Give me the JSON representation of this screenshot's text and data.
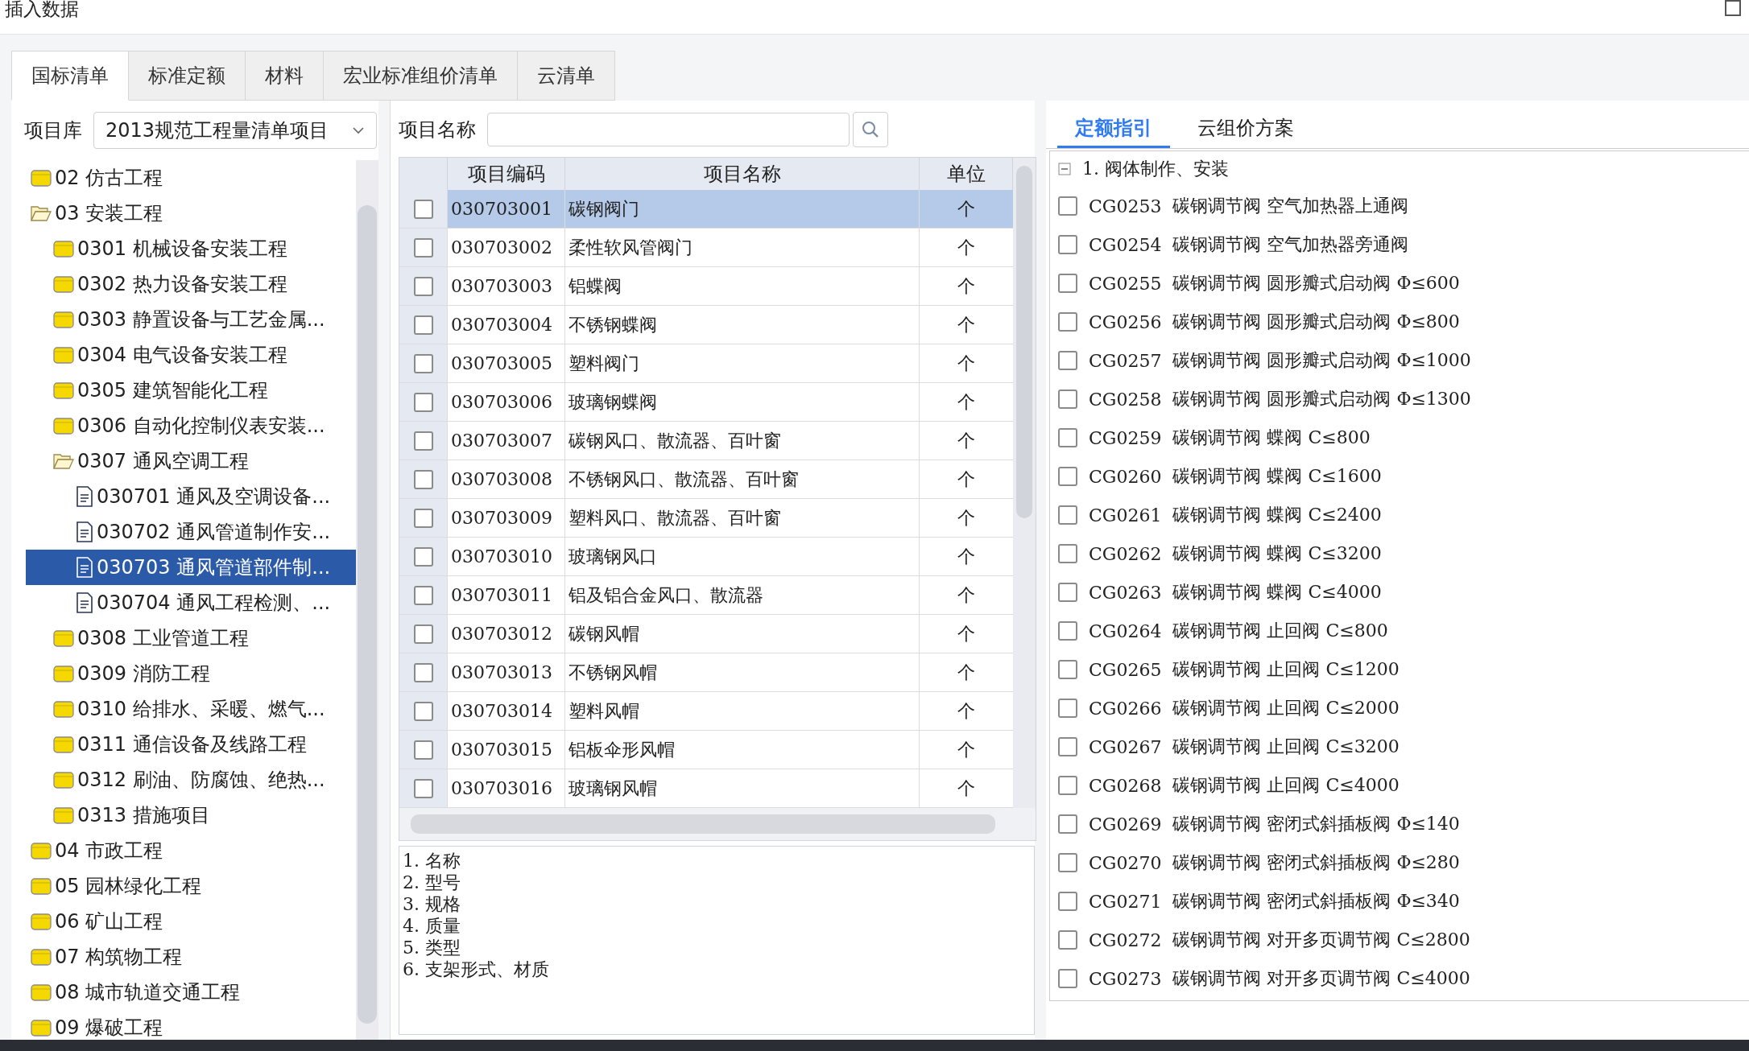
{
  "window": {
    "title": "插入数据"
  },
  "tabs": [
    {
      "label": "国标清单",
      "selected": true
    },
    {
      "label": "标准定额",
      "selected": false
    },
    {
      "label": "材料",
      "selected": false
    },
    {
      "label": "宏业标准组价清单",
      "selected": false
    },
    {
      "label": "云清单",
      "selected": false
    }
  ],
  "library": {
    "label": "项目库",
    "value": "2013规范工程量清单项目"
  },
  "tree": [
    {
      "label": "02 仿古工程",
      "kind": "folder",
      "expanded": false,
      "selected": false
    },
    {
      "label": "03 安装工程",
      "kind": "folder",
      "expanded": true,
      "selected": false,
      "children": [
        {
          "label": "0301 机械设备安装工程",
          "kind": "folder",
          "expanded": false,
          "selected": false
        },
        {
          "label": "0302 热力设备安装工程",
          "kind": "folder",
          "expanded": false,
          "selected": false
        },
        {
          "label": "0303 静置设备与工艺金属...",
          "kind": "folder",
          "expanded": false,
          "selected": false
        },
        {
          "label": "0304 电气设备安装工程",
          "kind": "folder",
          "expanded": false,
          "selected": false
        },
        {
          "label": "0305 建筑智能化工程",
          "kind": "folder",
          "expanded": false,
          "selected": false
        },
        {
          "label": "0306 自动化控制仪表安装...",
          "kind": "folder",
          "expanded": false,
          "selected": false
        },
        {
          "label": "0307 通风空调工程",
          "kind": "folder",
          "expanded": true,
          "selected": false,
          "children": [
            {
              "label": "030701 通风及空调设备...",
              "kind": "doc",
              "selected": false
            },
            {
              "label": "030702 通风管道制作安...",
              "kind": "doc",
              "selected": false
            },
            {
              "label": "030703 通风管道部件制...",
              "kind": "doc",
              "selected": true
            },
            {
              "label": "030704 通风工程检测、...",
              "kind": "doc",
              "selected": false
            }
          ]
        },
        {
          "label": "0308 工业管道工程",
          "kind": "folder",
          "expanded": false,
          "selected": false
        },
        {
          "label": "0309 消防工程",
          "kind": "folder",
          "expanded": false,
          "selected": false
        },
        {
          "label": "0310 给排水、采暖、燃气...",
          "kind": "folder",
          "expanded": false,
          "selected": false
        },
        {
          "label": "0311 通信设备及线路工程",
          "kind": "folder",
          "expanded": false,
          "selected": false
        },
        {
          "label": "0312 刷油、防腐蚀、绝热...",
          "kind": "folder",
          "expanded": false,
          "selected": false
        },
        {
          "label": "0313 措施项目",
          "kind": "folder",
          "expanded": false,
          "selected": false
        }
      ]
    },
    {
      "label": "04 市政工程",
      "kind": "folder",
      "expanded": false,
      "selected": false
    },
    {
      "label": "05 园林绿化工程",
      "kind": "folder",
      "expanded": false,
      "selected": false
    },
    {
      "label": "06 矿山工程",
      "kind": "folder",
      "expanded": false,
      "selected": false
    },
    {
      "label": "07 构筑物工程",
      "kind": "folder",
      "expanded": false,
      "selected": false
    },
    {
      "label": "08 城市轨道交通工程",
      "kind": "folder",
      "expanded": false,
      "selected": false
    },
    {
      "label": "09 爆破工程",
      "kind": "folder",
      "expanded": false,
      "selected": false
    }
  ],
  "search": {
    "label": "项目名称"
  },
  "table": {
    "columns": [
      "项目编码",
      "项目名称",
      "单位"
    ],
    "rows": [
      {
        "code": "030703001",
        "name": "碳钢阀门",
        "unit": "个",
        "checked": false,
        "selected": true
      },
      {
        "code": "030703002",
        "name": "柔性软风管阀门",
        "unit": "个",
        "checked": false,
        "selected": false
      },
      {
        "code": "030703003",
        "name": "铝蝶阀",
        "unit": "个",
        "checked": false,
        "selected": false
      },
      {
        "code": "030703004",
        "name": "不锈钢蝶阀",
        "unit": "个",
        "checked": false,
        "selected": false
      },
      {
        "code": "030703005",
        "name": "塑料阀门",
        "unit": "个",
        "checked": false,
        "selected": false
      },
      {
        "code": "030703006",
        "name": "玻璃钢蝶阀",
        "unit": "个",
        "checked": false,
        "selected": false
      },
      {
        "code": "030703007",
        "name": "碳钢风口、散流器、百叶窗",
        "unit": "个",
        "checked": false,
        "selected": false
      },
      {
        "code": "030703008",
        "name": "不锈钢风口、散流器、百叶窗",
        "unit": "个",
        "checked": false,
        "selected": false
      },
      {
        "code": "030703009",
        "name": "塑料风口、散流器、百叶窗",
        "unit": "个",
        "checked": false,
        "selected": false
      },
      {
        "code": "030703010",
        "name": "玻璃钢风口",
        "unit": "个",
        "checked": false,
        "selected": false
      },
      {
        "code": "030703011",
        "name": "铝及铝合金风口、散流器",
        "unit": "个",
        "checked": false,
        "selected": false
      },
      {
        "code": "030703012",
        "name": "碳钢风帽",
        "unit": "个",
        "checked": false,
        "selected": false
      },
      {
        "code": "030703013",
        "name": "不锈钢风帽",
        "unit": "个",
        "checked": false,
        "selected": false
      },
      {
        "code": "030703014",
        "name": "塑料风帽",
        "unit": "个",
        "checked": false,
        "selected": false
      },
      {
        "code": "030703015",
        "name": "铝板伞形风帽",
        "unit": "个",
        "checked": false,
        "selected": false
      },
      {
        "code": "030703016",
        "name": "玻璃钢风帽",
        "unit": "个",
        "checked": false,
        "selected": false
      }
    ]
  },
  "features": [
    "1. 名称",
    "2. 型号",
    "3. 规格",
    "4. 质量",
    "5. 类型",
    "6. 支架形式、材质"
  ],
  "right_tabs": [
    {
      "label": "定额指引",
      "selected": true
    },
    {
      "label": "云组价方案",
      "selected": false
    }
  ],
  "quota_group": {
    "label": "1. 阀体制作、安装",
    "expanded": true,
    "items": [
      {
        "code": "CG0253",
        "text": "碳钢调节阀 空气加热器上通阀",
        "checked": false
      },
      {
        "code": "CG0254",
        "text": "碳钢调节阀 空气加热器旁通阀",
        "checked": false
      },
      {
        "code": "CG0255",
        "text": "碳钢调节阀 圆形瓣式启动阀 Φ≤600",
        "checked": false
      },
      {
        "code": "CG0256",
        "text": "碳钢调节阀 圆形瓣式启动阀 Φ≤800",
        "checked": false
      },
      {
        "code": "CG0257",
        "text": "碳钢调节阀 圆形瓣式启动阀 Φ≤1000",
        "checked": false
      },
      {
        "code": "CG0258",
        "text": "碳钢调节阀 圆形瓣式启动阀 Φ≤1300",
        "checked": false
      },
      {
        "code": "CG0259",
        "text": "碳钢调节阀 蝶阀 C≤800",
        "checked": false
      },
      {
        "code": "CG0260",
        "text": "碳钢调节阀 蝶阀 C≤1600",
        "checked": false
      },
      {
        "code": "CG0261",
        "text": "碳钢调节阀 蝶阀 C≤2400",
        "checked": false
      },
      {
        "code": "CG0262",
        "text": "碳钢调节阀 蝶阀 C≤3200",
        "checked": false
      },
      {
        "code": "CG0263",
        "text": "碳钢调节阀 蝶阀 C≤4000",
        "checked": false
      },
      {
        "code": "CG0264",
        "text": "碳钢调节阀 止回阀 C≤800",
        "checked": false
      },
      {
        "code": "CG0265",
        "text": "碳钢调节阀 止回阀 C≤1200",
        "checked": false
      },
      {
        "code": "CG0266",
        "text": "碳钢调节阀 止回阀 C≤2000",
        "checked": false
      },
      {
        "code": "CG0267",
        "text": "碳钢调节阀 止回阀 C≤3200",
        "checked": false
      },
      {
        "code": "CG0268",
        "text": "碳钢调节阀 止回阀 C≤4000",
        "checked": false
      },
      {
        "code": "CG0269",
        "text": "碳钢调节阀 密闭式斜插板阀 Φ≤140",
        "checked": false
      },
      {
        "code": "CG0270",
        "text": "碳钢调节阀 密闭式斜插板阀 Φ≤280",
        "checked": false
      },
      {
        "code": "CG0271",
        "text": "碳钢调节阀 密闭式斜插板阀 Φ≤340",
        "checked": false
      },
      {
        "code": "CG0272",
        "text": "碳钢调节阀 对开多页调节阀 C≤2800",
        "checked": false
      },
      {
        "code": "CG0273",
        "text": "碳钢调节阀 对开多页调节阀 C≤4000",
        "checked": false
      }
    ]
  }
}
